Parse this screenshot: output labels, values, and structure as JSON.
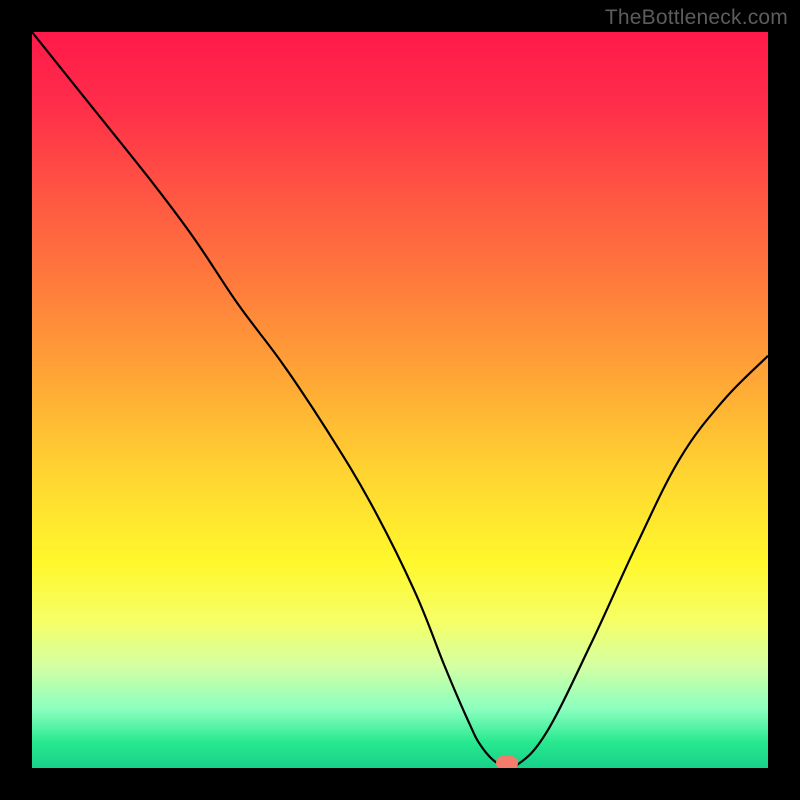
{
  "watermark": "TheBottleneck.com",
  "marker_color": "#f47c6c",
  "curve_color": "#000000",
  "curve_stroke_width": 2.2,
  "gradient_stops": [
    {
      "offset": 0.0,
      "color": "#ff1a4b"
    },
    {
      "offset": 0.1,
      "color": "#ff2e4a"
    },
    {
      "offset": 0.22,
      "color": "#ff5643"
    },
    {
      "offset": 0.35,
      "color": "#ff7e3c"
    },
    {
      "offset": 0.48,
      "color": "#ffaa36"
    },
    {
      "offset": 0.6,
      "color": "#ffd531"
    },
    {
      "offset": 0.72,
      "color": "#fff82d"
    },
    {
      "offset": 0.8,
      "color": "#f6ff66"
    },
    {
      "offset": 0.86,
      "color": "#d6ffa3"
    },
    {
      "offset": 0.92,
      "color": "#8cffc0"
    },
    {
      "offset": 0.965,
      "color": "#28e98f"
    },
    {
      "offset": 1.0,
      "color": "#17d18a"
    }
  ],
  "chart_data": {
    "type": "line",
    "title": "",
    "xlabel": "",
    "ylabel": "",
    "x_range": [
      0,
      100
    ],
    "y_range": [
      0,
      100
    ],
    "series": [
      {
        "name": "bottleneck-curve",
        "x": [
          0,
          8,
          16,
          22,
          28,
          34,
          40,
          46,
          52,
          56,
          59,
          61,
          63.5,
          66,
          70,
          76,
          82,
          88,
          94,
          100
        ],
        "y": [
          100,
          90,
          80,
          72,
          63,
          55,
          46,
          36,
          24,
          14,
          7,
          3,
          0.5,
          0.5,
          5,
          17,
          30,
          42,
          50,
          56
        ]
      }
    ],
    "marker": {
      "x": 64.5,
      "y": 0.7
    },
    "flat_min_range_x": [
      60,
      67
    ]
  }
}
